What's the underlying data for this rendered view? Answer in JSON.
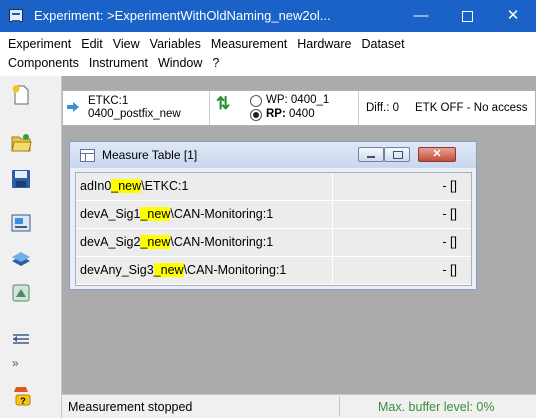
{
  "window": {
    "title": "Experiment: >ExperimentWithOldNaming_new2ol...",
    "minimize_glyph": "—",
    "close_glyph": "✕"
  },
  "menu": {
    "row1": [
      "Experiment",
      "Edit",
      "View",
      "Variables",
      "Measurement",
      "Hardware",
      "Dataset"
    ],
    "row2": [
      "Components",
      "Instrument",
      "Window",
      "?"
    ]
  },
  "etk": {
    "name_line1": "ETKC:1",
    "name_line2": "0400_postfix_new",
    "wp_label": "WP: 0400_1",
    "rp_label": "RP:",
    "rp_value": "0400",
    "diff": "Diff.: 0",
    "status": "ETK OFF - No access"
  },
  "measure_table": {
    "title": "Measure Table [1]",
    "close_glyph": "✕",
    "rows": [
      {
        "prefix": "adIn0",
        "highlight": "_new",
        "suffix": "\\ETKC:1",
        "value": "- []"
      },
      {
        "prefix": "devA_Sig1",
        "highlight": "_new",
        "suffix": "\\CAN-Monitoring:1",
        "value": "- []"
      },
      {
        "prefix": "devA_Sig2",
        "highlight": "_new",
        "suffix": "\\CAN-Monitoring:1",
        "value": "- []"
      },
      {
        "prefix": "devAny_Sig3",
        "highlight": "_new",
        "suffix": "\\CAN-Monitoring:1",
        "value": "- []"
      }
    ]
  },
  "toolbox": {
    "icons": [
      "document-icon",
      "open-folder-icon",
      "save-disk-icon",
      "hardware-card-icon",
      "layers-icon",
      "model-icon",
      "list-arrow-icon"
    ],
    "more_glyph": "»"
  },
  "status": {
    "left": "Measurement stopped",
    "right": "Max. buffer level: 0%"
  },
  "colors": {
    "titlebar": "#1a62c7",
    "highlight": "#ffff00",
    "status_ok": "#3a8e3a"
  }
}
